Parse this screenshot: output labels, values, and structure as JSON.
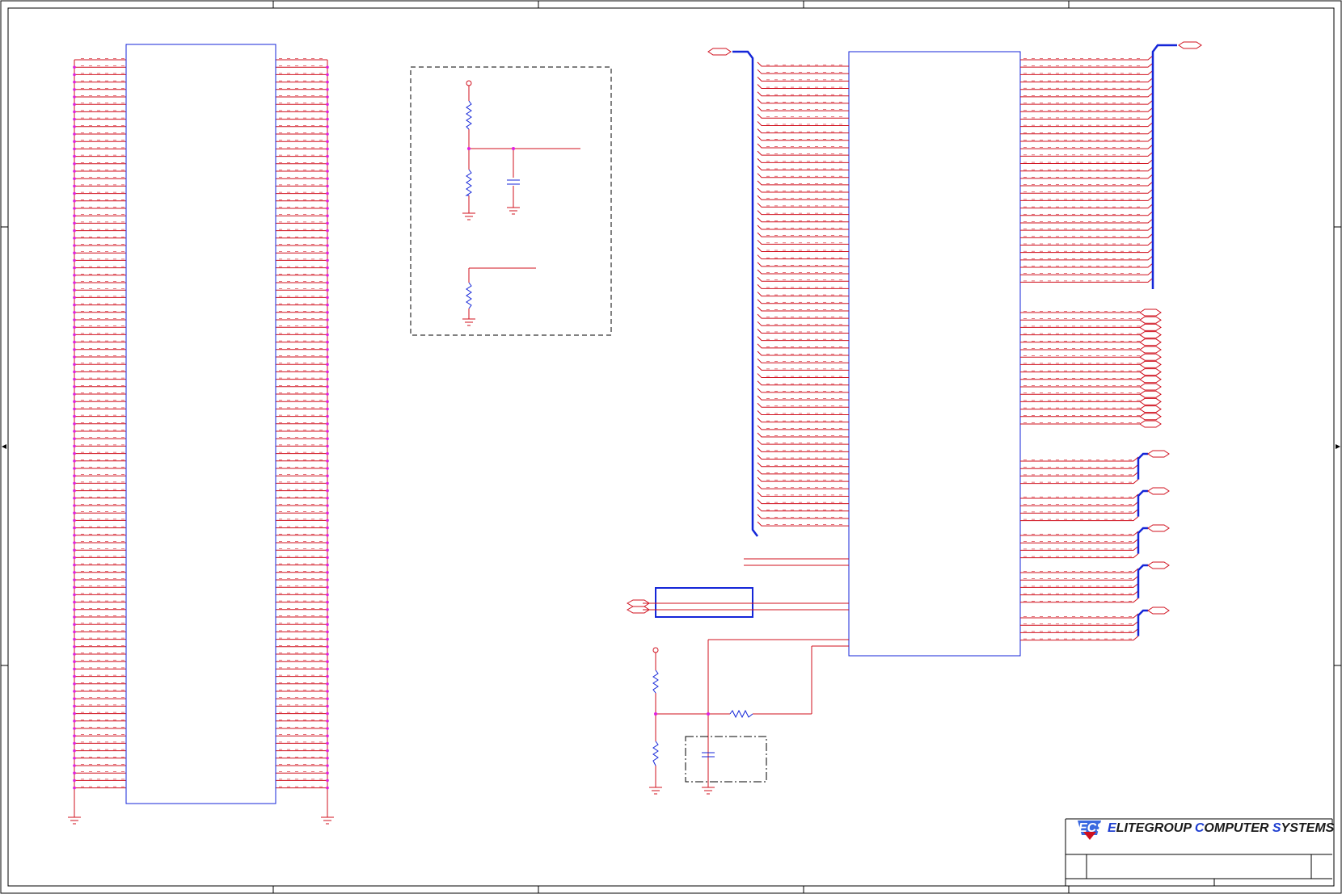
{
  "title_block": {
    "company_initials": [
      "E",
      "C",
      "S"
    ],
    "company_rest": [
      "LITEGROUP ",
      "OMPUTER ",
      "YSTEMS"
    ],
    "logo": "ECS"
  },
  "colors": {
    "wire": "#d0101e",
    "component": "#1426d8",
    "junction": "#e020e0",
    "frame": "#000000",
    "bus": "#1426d8"
  },
  "diagram": {
    "type": "circuit-schematic",
    "components": [
      "connector-left",
      "main-ic-right",
      "divider-resistor-top",
      "divider-resistor-bottom",
      "filter-capacitor",
      "pulldown-resistor",
      "series-resistor-block",
      "lower-divider-top",
      "lower-divider-bottom",
      "lower-capacitor",
      "bias-resistor"
    ]
  }
}
